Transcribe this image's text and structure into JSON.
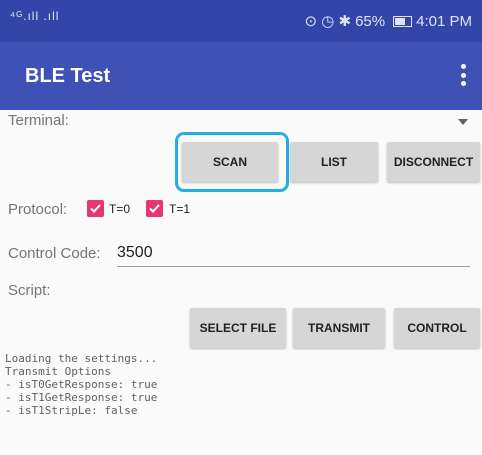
{
  "statusbar": {
    "signal_text": "⁴ᴳ.ıll  .ıll",
    "icons_text": "⊙ ◷ ✱",
    "battery": "65%",
    "time": "4:01 PM"
  },
  "app": {
    "title": "BLE Test"
  },
  "terminal": {
    "label": "Terminal:"
  },
  "buttons": {
    "scan": "SCAN",
    "list": "LIST",
    "disconnect": "DISCONNECT",
    "select_file": "SELECT FILE",
    "transmit": "TRANSMIT",
    "control": "CONTROL"
  },
  "protocol": {
    "label": "Protocol:",
    "options": [
      {
        "label": "T=0",
        "checked": true
      },
      {
        "label": "T=1",
        "checked": true
      }
    ]
  },
  "control_code": {
    "label": "Control Code:",
    "value": "3500"
  },
  "script": {
    "label": "Script:"
  },
  "log": [
    "Loading the settings...",
    "Transmit Options",
    "- isT0GetResponse: true",
    "- isT1GetResponse: true",
    "- isT1StripLe: false"
  ],
  "colors": {
    "appbar": "#3f51b5",
    "statusbar": "#3345a8",
    "checkbox": "#e5386f",
    "highlight": "#25aee6"
  }
}
